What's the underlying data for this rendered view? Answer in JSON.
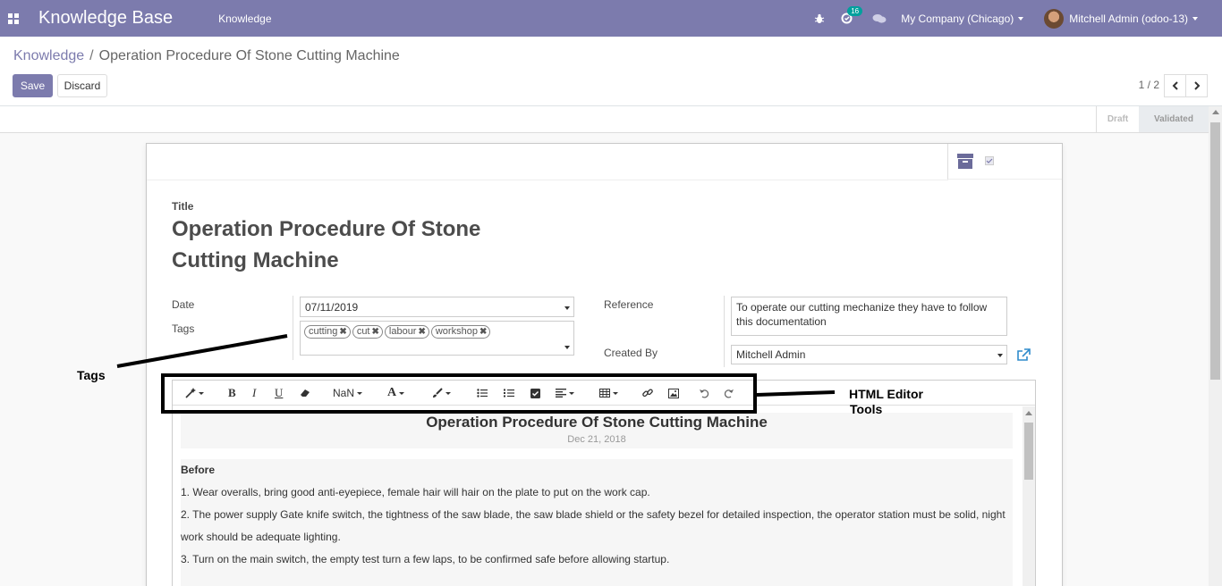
{
  "navbar": {
    "brand": "Knowledge Base",
    "menu": [
      "Knowledge"
    ],
    "activity_badge": "16",
    "company": "My Company (Chicago)",
    "user": "Mitchell Admin (odoo-13)",
    "icons": [
      "apps-icon",
      "bug-icon",
      "activity-icon",
      "chat-icon",
      "avatar"
    ]
  },
  "breadcrumb": {
    "parent": "Knowledge",
    "separator": "/",
    "current": "Operation Procedure Of Stone Cutting Machine"
  },
  "buttons": {
    "save": "Save",
    "discard": "Discard"
  },
  "pager": {
    "text": "1 / 2"
  },
  "status": {
    "stages": [
      "Draft",
      "Validated"
    ],
    "active": "Validated"
  },
  "form": {
    "title_label": "Title",
    "title": "Operation Procedure Of Stone Cutting Machine",
    "date_label": "Date",
    "date": "07/11/2019",
    "tags_label": "Tags",
    "tags": [
      "cutting",
      "cut",
      "labour",
      "workshop"
    ],
    "reference_label": "Reference",
    "reference": "To operate our cutting mechanize they have to follow this documentation",
    "created_by_label": "Created By",
    "created_by": "Mitchell Admin"
  },
  "editor": {
    "toolbar": [
      "magic-wand-icon",
      "bold-icon",
      "italic-icon",
      "underline-icon",
      "eraser-icon",
      "font-size-select",
      "font-color-icon",
      "highlight-brush-icon",
      "bullet-list-icon",
      "numbered-list-icon",
      "checklist-icon",
      "align-icon",
      "table-icon",
      "link-icon",
      "image-icon",
      "undo-icon",
      "redo-icon"
    ],
    "font_size_value": "NaN",
    "doc_title": "Operation Procedure Of Stone Cutting Machine",
    "doc_date": "Dec 21, 2018",
    "section": "Before",
    "lines": [
      "1. Wear overalls, bring good anti-eyepiece, female hair will hair on the plate to put on the work cap.",
      "2. The power supply Gate knife switch, the tightness of the saw blade, the saw blade shield or the safety bezel for detailed inspection, the operator station must be solid, night work should be adequate lighting.",
      "3. Turn on the main switch, the empty test turn a few laps, to be confirmed safe before allowing startup."
    ]
  },
  "annotations": {
    "tags": "Tags",
    "editor_line1": "HTML Editor",
    "editor_line2": "Tools"
  },
  "colors": {
    "navbar": "#7c7bad",
    "primary": "#7c7bad",
    "badge": "#00a09d",
    "link": "#2f8bcc"
  }
}
